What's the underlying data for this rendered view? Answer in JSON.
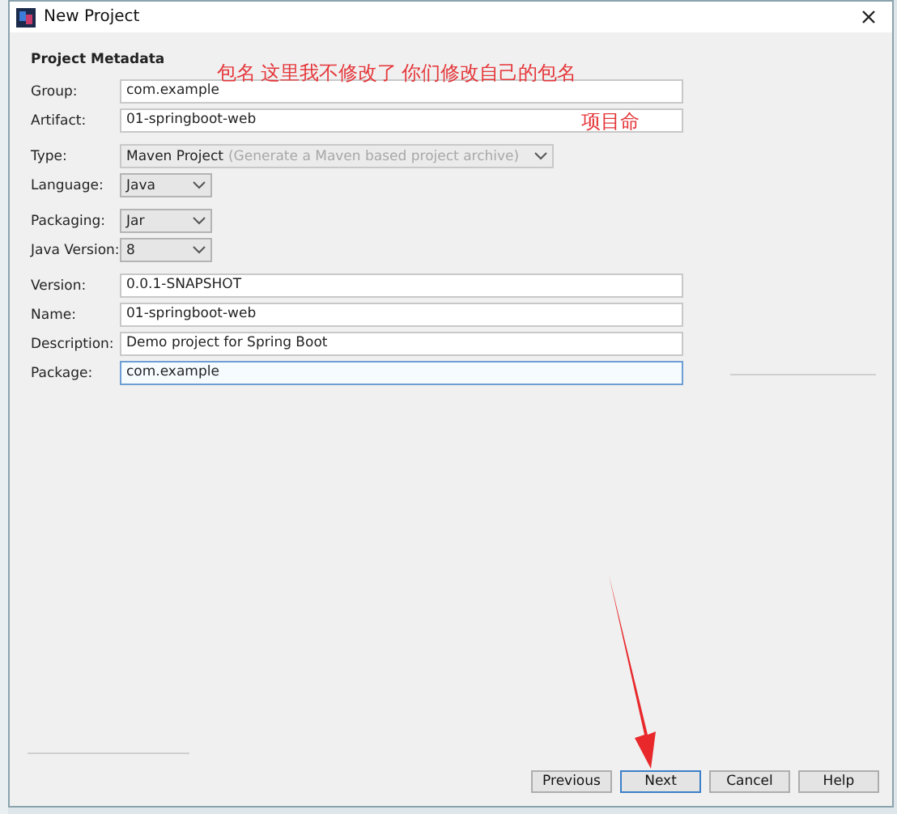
{
  "window": {
    "title": "New Project"
  },
  "section": {
    "title": "Project Metadata"
  },
  "fields": [
    {
      "label": "Group:",
      "kind": "text",
      "value": "com.example",
      "focused": false
    },
    {
      "label": "Artifact:",
      "kind": "text",
      "value": "01-springboot-web",
      "focused": false
    },
    {
      "label": "Type:",
      "kind": "select",
      "value": "Maven Project",
      "hint": "(Generate a Maven based project archive)",
      "disabled": true
    },
    {
      "label": "Language:",
      "kind": "select",
      "value": "Java",
      "disabled": false
    },
    {
      "label": "Packaging:",
      "kind": "select",
      "value": "Jar",
      "disabled": false
    },
    {
      "label": "Java Version:",
      "kind": "select",
      "value": "8",
      "disabled": false
    },
    {
      "label": "Version:",
      "kind": "text",
      "value": "0.0.1-SNAPSHOT",
      "focused": false
    },
    {
      "label": "Name:",
      "kind": "text",
      "value": "01-springboot-web",
      "focused": false
    },
    {
      "label": "Description:",
      "kind": "text",
      "value": "Demo project for Spring Boot",
      "focused": false
    },
    {
      "label": "Package:",
      "kind": "text",
      "value": "com.example",
      "focused": true
    }
  ],
  "annotations": [
    "包名 这里我不修改了 你们修改自己的包名",
    "项目命"
  ],
  "buttons": [
    {
      "label": "Previous",
      "default": false
    },
    {
      "label": "Next",
      "default": true
    },
    {
      "label": "Cancel",
      "default": false
    },
    {
      "label": "Help",
      "default": false
    }
  ]
}
